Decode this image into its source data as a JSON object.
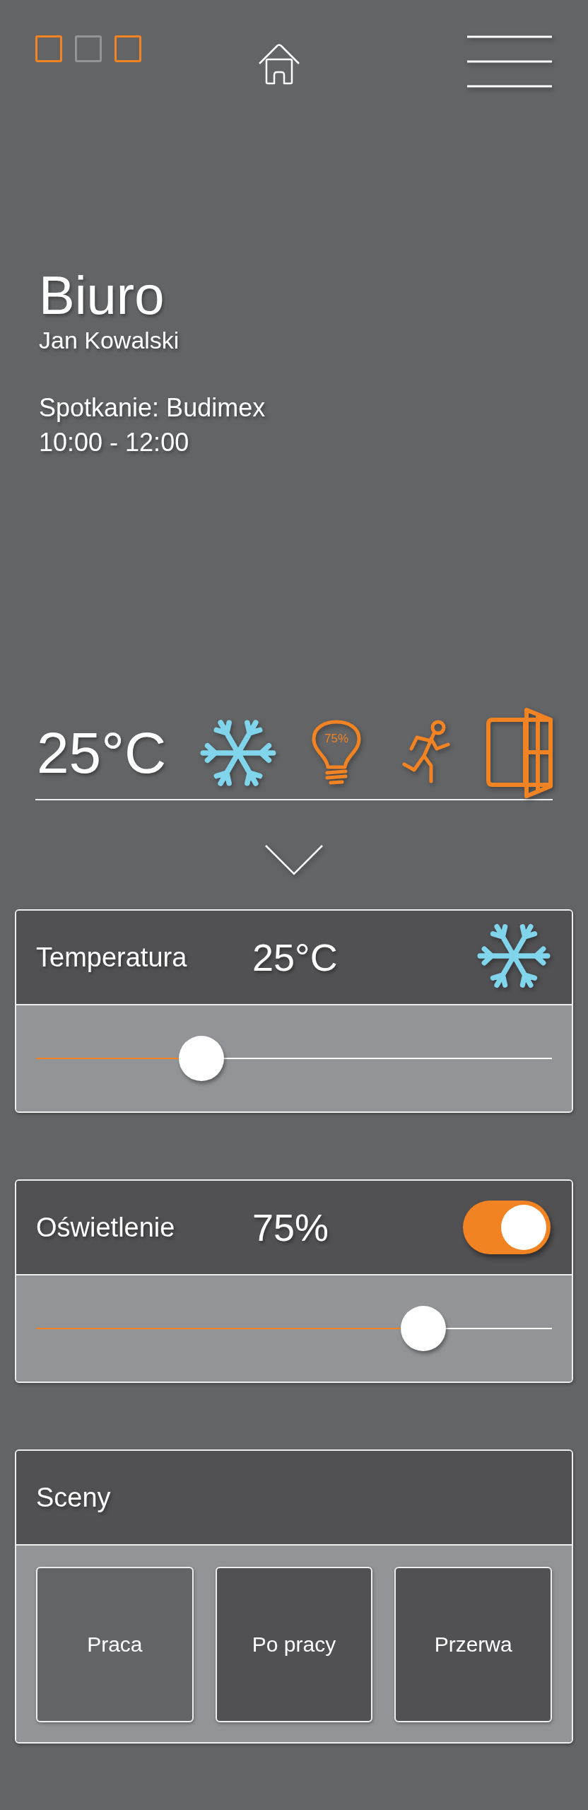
{
  "indicators": [
    {
      "active": true
    },
    {
      "active": false
    },
    {
      "active": true
    }
  ],
  "room": {
    "name": "Biuro",
    "person": "Jan Kowalski",
    "event": "Spotkanie: Budimex",
    "time": "10:00 - 12:00"
  },
  "status": {
    "temperature": "25°C",
    "icons": [
      {
        "kind": "cooling"
      },
      {
        "kind": "light",
        "label": "75%"
      },
      {
        "kind": "motion"
      },
      {
        "kind": "door"
      }
    ]
  },
  "panels": [
    {
      "kind": "temperature",
      "title": "Temperatura",
      "value": "25°C",
      "level": 0.32
    },
    {
      "kind": "light",
      "title": "Oświetlenie",
      "value": "75%",
      "on": true,
      "level": 0.75
    },
    {
      "kind": "scenes",
      "title": "Sceny",
      "scenes": [
        {
          "label": "Praca",
          "selected": true
        },
        {
          "label": "Po pracy",
          "selected": false
        },
        {
          "label": "Przerwa",
          "selected": false
        }
      ]
    }
  ]
}
